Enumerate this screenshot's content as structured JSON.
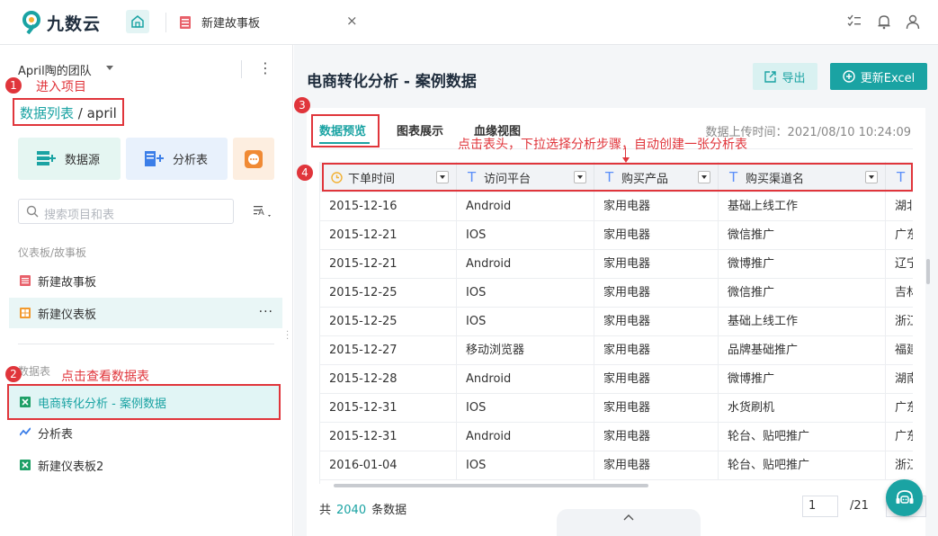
{
  "app": {
    "brand": "九数云",
    "tab_title": "新建故事板",
    "tab_close": "×"
  },
  "sidebar": {
    "team": "April陶的团队",
    "more": "⋮",
    "breadcrumb_link": "数据列表",
    "breadcrumb_rest": " / april",
    "cards": [
      {
        "label": "数据源",
        "icon": "add-datasource-icon"
      },
      {
        "label": "分析表",
        "icon": "add-analysis-icon"
      },
      {
        "label": "",
        "icon": "more-apps-icon"
      }
    ],
    "search_placeholder": "搜索项目和表",
    "sort_label": "A",
    "section_dashboards": "仪表板/故事板",
    "dashboards": [
      {
        "label": "新建故事板",
        "icon": "storyboard-icon",
        "color": "#e8606a"
      },
      {
        "label": "新建仪表板",
        "icon": "dashboard-icon",
        "color": "#f29a2e",
        "more": "···"
      }
    ],
    "section_tables": "数据表",
    "tables": [
      {
        "label": "电商转化分析 - 案例数据",
        "icon": "excel-icon",
        "color": "#1fa067"
      },
      {
        "label": "分析表",
        "icon": "analysis-icon",
        "color": "#3b7ee8"
      },
      {
        "label": "新建仪表板2",
        "icon": "excel-icon",
        "color": "#1fa067"
      }
    ]
  },
  "annotations": {
    "m1": "1",
    "a1": "进入项目",
    "m2": "2",
    "a2": "点击查看数据表",
    "m3": "3",
    "m4": "4",
    "a3": "点击表头，下拉选择分析步骤，自动创建一张分析表"
  },
  "main": {
    "title": "电商转化分析 - 案例数据",
    "export_label": "导出",
    "update_label": "更新Excel",
    "tabs": [
      "数据预览",
      "图表展示",
      "血缘视图"
    ],
    "upload_time": "数据上传时间：2021/08/10 10:24:09",
    "columns": [
      {
        "type_icon": "clock-icon",
        "label": "下单时间"
      },
      {
        "type_icon": "T",
        "label": "访问平台"
      },
      {
        "type_icon": "T",
        "label": "购买产品"
      },
      {
        "type_icon": "T",
        "label": "购买渠道名"
      },
      {
        "type_icon": "T",
        "label": ""
      }
    ],
    "rows": [
      [
        "2015-12-16",
        "Android",
        "家用电器",
        "基础上线工作",
        "湖北"
      ],
      [
        "2015-12-21",
        "IOS",
        "家用电器",
        "微信推广",
        "广东"
      ],
      [
        "2015-12-21",
        "Android",
        "家用电器",
        "微博推广",
        "辽宁"
      ],
      [
        "2015-12-25",
        "IOS",
        "家用电器",
        "微信推广",
        "吉林"
      ],
      [
        "2015-12-25",
        "IOS",
        "家用电器",
        "基础上线工作",
        "浙江"
      ],
      [
        "2015-12-27",
        "移动浏览器",
        "家用电器",
        "品牌基础推广",
        "福建"
      ],
      [
        "2015-12-28",
        "Android",
        "家用电器",
        "微博推广",
        "湖南"
      ],
      [
        "2015-12-31",
        "IOS",
        "家用电器",
        "水货刷机",
        "广东"
      ],
      [
        "2015-12-31",
        "Android",
        "家用电器",
        "轮台、贴吧推广",
        "广东"
      ],
      [
        "2016-01-04",
        "IOS",
        "家用电器",
        "轮台、贴吧推广",
        "浙江"
      ]
    ],
    "footer_prefix": "共",
    "total": "2040",
    "footer_suffix": "条数据",
    "page_current": "1",
    "page_total": "/21"
  },
  "colors": {
    "accent": "#1aa3a3",
    "annotation_red": "#e0353b"
  }
}
